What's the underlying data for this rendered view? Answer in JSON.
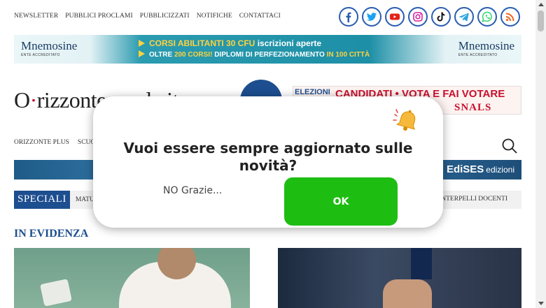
{
  "topnav": [
    "NEWSLETTER",
    "PUBBLICI PROCLAMI",
    "PUBBLICIZZATI",
    "NOTIFICHE",
    "CONTATTACI"
  ],
  "social": [
    {
      "icon": "facebook-icon",
      "color": "#2a5db0"
    },
    {
      "icon": "twitter-icon",
      "color": "#1da1f2"
    },
    {
      "icon": "youtube-icon",
      "color": "#e62117"
    },
    {
      "icon": "instagram-icon",
      "color": "#d6249f"
    },
    {
      "icon": "tiktok-icon",
      "color": "#111111"
    },
    {
      "icon": "telegram-icon",
      "color": "#2ca5e0"
    },
    {
      "icon": "whatsapp-icon",
      "color": "#25d366"
    },
    {
      "icon": "rss-icon",
      "color": "#f26522"
    }
  ],
  "banner1": {
    "brand": "Mnemosine",
    "brand_sub": "ENTE ACCREDITATO",
    "line1_highlight": "CORSI ABILITANTI 30 CFU",
    "line1_rest": "iscrizioni aperte",
    "line2_a": "OLTRE",
    "line2_b": "200 CORSI!",
    "line2_c": "DIPLOMI DI PERFEZIONAMENTO",
    "line2_d": "IN 100 CITTÀ"
  },
  "logo": {
    "text_a": "O",
    "text_b": "rizzonte",
    "text_c": "scuola.it"
  },
  "banner2": {
    "t1": "ELEZIONI",
    "t2": "CANDIDATI • VOTA E FAI VOTARE",
    "t3": "SNALS"
  },
  "mainnav": [
    "ORIZZONTE PLUS",
    "SCUOLA"
  ],
  "banner3": {
    "brand": "EdiSES",
    "sub": "edizioni"
  },
  "speciali": {
    "tag": "SPECIALI",
    "item": "MATURITÀ",
    "right": "INTERPELLI DOCENTI"
  },
  "section_title": "IN EVIDENZA",
  "modal": {
    "message": "Vuoi essere sempre aggiornato sulle novità?",
    "no_label": "NO Grazie...",
    "ok_label": "OK",
    "ok_color": "#1ebd12"
  }
}
